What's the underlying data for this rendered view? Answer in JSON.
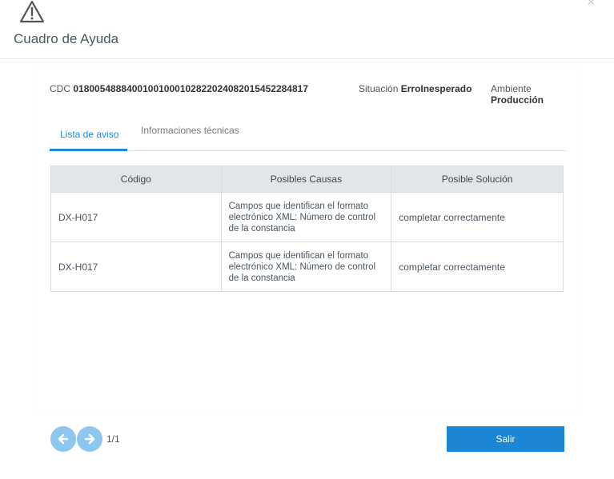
{
  "header": {
    "title": "Cuadro de Ayuda",
    "icon": "warning-icon"
  },
  "info": {
    "cdc_label": "CDC",
    "cdc_value": "01800548884001001000102822024082015452284817",
    "situacion_label": "Situación",
    "situacion_value": "ErroInesperado",
    "ambiente_label": "Ambiente",
    "ambiente_value": "Producción"
  },
  "tabs": [
    {
      "label": "Lista de aviso",
      "active": true
    },
    {
      "label": "Informaciones técnicas",
      "active": false
    }
  ],
  "table": {
    "headers": [
      "Código",
      "Posibles Causas",
      "Posible Solución"
    ],
    "rows": [
      {
        "codigo": "DX-H017",
        "causa": "Campos que identifican el formato electrónico XML: Número de control de la constancia",
        "solucion": "completar correctamente"
      },
      {
        "codigo": "DX-H017",
        "causa": "Campos que identifican el formato electrónico XML: Número de control de la constancia",
        "solucion": "completar correctamente"
      }
    ]
  },
  "pagination": {
    "current": "1/1"
  },
  "footer": {
    "exit_label": "Salir"
  },
  "colors": {
    "accent": "#1a86d4",
    "nav_button": "#8ec7ee",
    "table_header": "#e1e6ea",
    "title": "#455a64"
  }
}
